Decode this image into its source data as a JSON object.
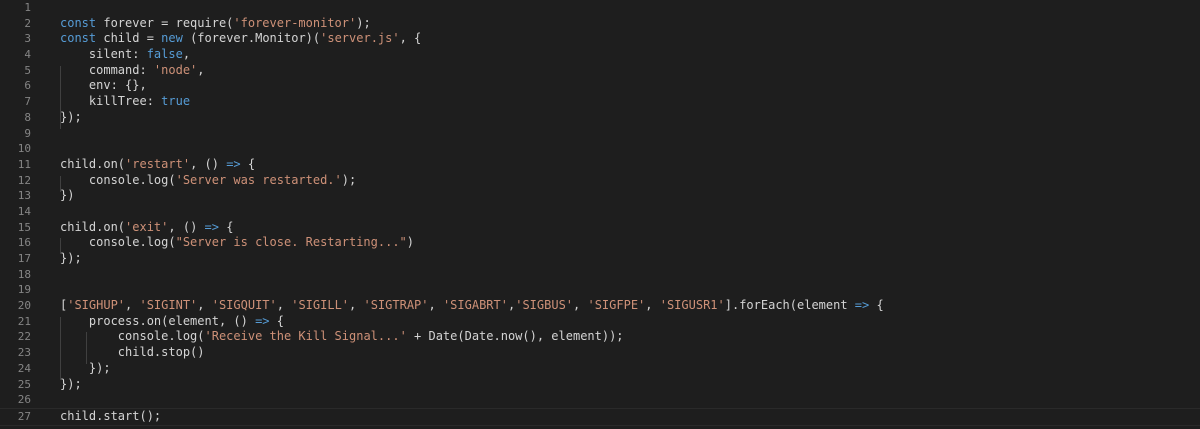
{
  "colors": {
    "background": "#1e1e1e",
    "text": "#d4d4d4",
    "keyword": "#569cd6",
    "string": "#ce9178",
    "line_number": "#858585"
  },
  "lines": [
    {
      "n": "1",
      "tokens": []
    },
    {
      "n": "2",
      "tokens": [
        {
          "t": "kw",
          "v": "const"
        },
        {
          "t": "pl",
          "v": " forever = require("
        },
        {
          "t": "str",
          "v": "'forever-monitor'"
        },
        {
          "t": "pl",
          "v": ");"
        }
      ]
    },
    {
      "n": "3",
      "tokens": [
        {
          "t": "kw",
          "v": "const"
        },
        {
          "t": "pl",
          "v": " child = "
        },
        {
          "t": "kw",
          "v": "new"
        },
        {
          "t": "pl",
          "v": " (forever.Monitor)("
        },
        {
          "t": "str",
          "v": "'server.js'"
        },
        {
          "t": "pl",
          "v": ", {"
        }
      ]
    },
    {
      "n": "4",
      "tokens": [
        {
          "t": "pl",
          "v": "    silent: "
        },
        {
          "t": "kw",
          "v": "false"
        },
        {
          "t": "pl",
          "v": ","
        }
      ]
    },
    {
      "n": "5",
      "tokens": [
        {
          "t": "pl",
          "v": "    command: "
        },
        {
          "t": "str",
          "v": "'node'"
        },
        {
          "t": "pl",
          "v": ","
        }
      ]
    },
    {
      "n": "6",
      "tokens": [
        {
          "t": "pl",
          "v": "    env: {},"
        }
      ]
    },
    {
      "n": "7",
      "tokens": [
        {
          "t": "pl",
          "v": "    killTree: "
        },
        {
          "t": "kw",
          "v": "true"
        }
      ]
    },
    {
      "n": "8",
      "tokens": [
        {
          "t": "pl",
          "v": "});"
        }
      ]
    },
    {
      "n": "9",
      "tokens": []
    },
    {
      "n": "10",
      "tokens": []
    },
    {
      "n": "11",
      "tokens": [
        {
          "t": "pl",
          "v": "child.on("
        },
        {
          "t": "str",
          "v": "'restart'"
        },
        {
          "t": "pl",
          "v": ", () "
        },
        {
          "t": "kw",
          "v": "=>"
        },
        {
          "t": "pl",
          "v": " {"
        }
      ]
    },
    {
      "n": "12",
      "tokens": [
        {
          "t": "pl",
          "v": "    console.log("
        },
        {
          "t": "str",
          "v": "'Server was restarted.'"
        },
        {
          "t": "pl",
          "v": ");"
        }
      ]
    },
    {
      "n": "13",
      "tokens": [
        {
          "t": "pl",
          "v": "})"
        }
      ]
    },
    {
      "n": "14",
      "tokens": []
    },
    {
      "n": "15",
      "tokens": [
        {
          "t": "pl",
          "v": "child.on("
        },
        {
          "t": "str",
          "v": "'exit'"
        },
        {
          "t": "pl",
          "v": ", () "
        },
        {
          "t": "kw",
          "v": "=>"
        },
        {
          "t": "pl",
          "v": " {"
        }
      ]
    },
    {
      "n": "16",
      "tokens": [
        {
          "t": "pl",
          "v": "    console.log("
        },
        {
          "t": "str",
          "v": "\"Server is close. Restarting...\""
        },
        {
          "t": "pl",
          "v": ")"
        }
      ]
    },
    {
      "n": "17",
      "tokens": [
        {
          "t": "pl",
          "v": "});"
        }
      ]
    },
    {
      "n": "18",
      "tokens": []
    },
    {
      "n": "19",
      "tokens": []
    },
    {
      "n": "20",
      "tokens": [
        {
          "t": "pl",
          "v": "["
        },
        {
          "t": "str",
          "v": "'SIGHUP'"
        },
        {
          "t": "pl",
          "v": ", "
        },
        {
          "t": "str",
          "v": "'SIGINT'"
        },
        {
          "t": "pl",
          "v": ", "
        },
        {
          "t": "str",
          "v": "'SIGQUIT'"
        },
        {
          "t": "pl",
          "v": ", "
        },
        {
          "t": "str",
          "v": "'SIGILL'"
        },
        {
          "t": "pl",
          "v": ", "
        },
        {
          "t": "str",
          "v": "'SIGTRAP'"
        },
        {
          "t": "pl",
          "v": ", "
        },
        {
          "t": "str",
          "v": "'SIGABRT'"
        },
        {
          "t": "pl",
          "v": ","
        },
        {
          "t": "str",
          "v": "'SIGBUS'"
        },
        {
          "t": "pl",
          "v": ", "
        },
        {
          "t": "str",
          "v": "'SIGFPE'"
        },
        {
          "t": "pl",
          "v": ", "
        },
        {
          "t": "str",
          "v": "'SIGUSR1'"
        },
        {
          "t": "pl",
          "v": "].forEach(element "
        },
        {
          "t": "kw",
          "v": "=>"
        },
        {
          "t": "pl",
          "v": " {"
        }
      ]
    },
    {
      "n": "21",
      "tokens": [
        {
          "t": "pl",
          "v": "    process.on(element, () "
        },
        {
          "t": "kw",
          "v": "=>"
        },
        {
          "t": "pl",
          "v": " {"
        }
      ]
    },
    {
      "n": "22",
      "tokens": [
        {
          "t": "pl",
          "v": "        console.log("
        },
        {
          "t": "str",
          "v": "'Receive the Kill Signal...'"
        },
        {
          "t": "pl",
          "v": " + Date(Date.now(), element));"
        }
      ]
    },
    {
      "n": "23",
      "tokens": [
        {
          "t": "pl",
          "v": "        child.stop()"
        }
      ]
    },
    {
      "n": "24",
      "tokens": [
        {
          "t": "pl",
          "v": "    });"
        }
      ]
    },
    {
      "n": "25",
      "tokens": [
        {
          "t": "pl",
          "v": "});"
        }
      ]
    },
    {
      "n": "26",
      "tokens": []
    },
    {
      "n": "27",
      "tokens": [
        {
          "t": "pl",
          "v": "child.start();"
        }
      ]
    }
  ]
}
